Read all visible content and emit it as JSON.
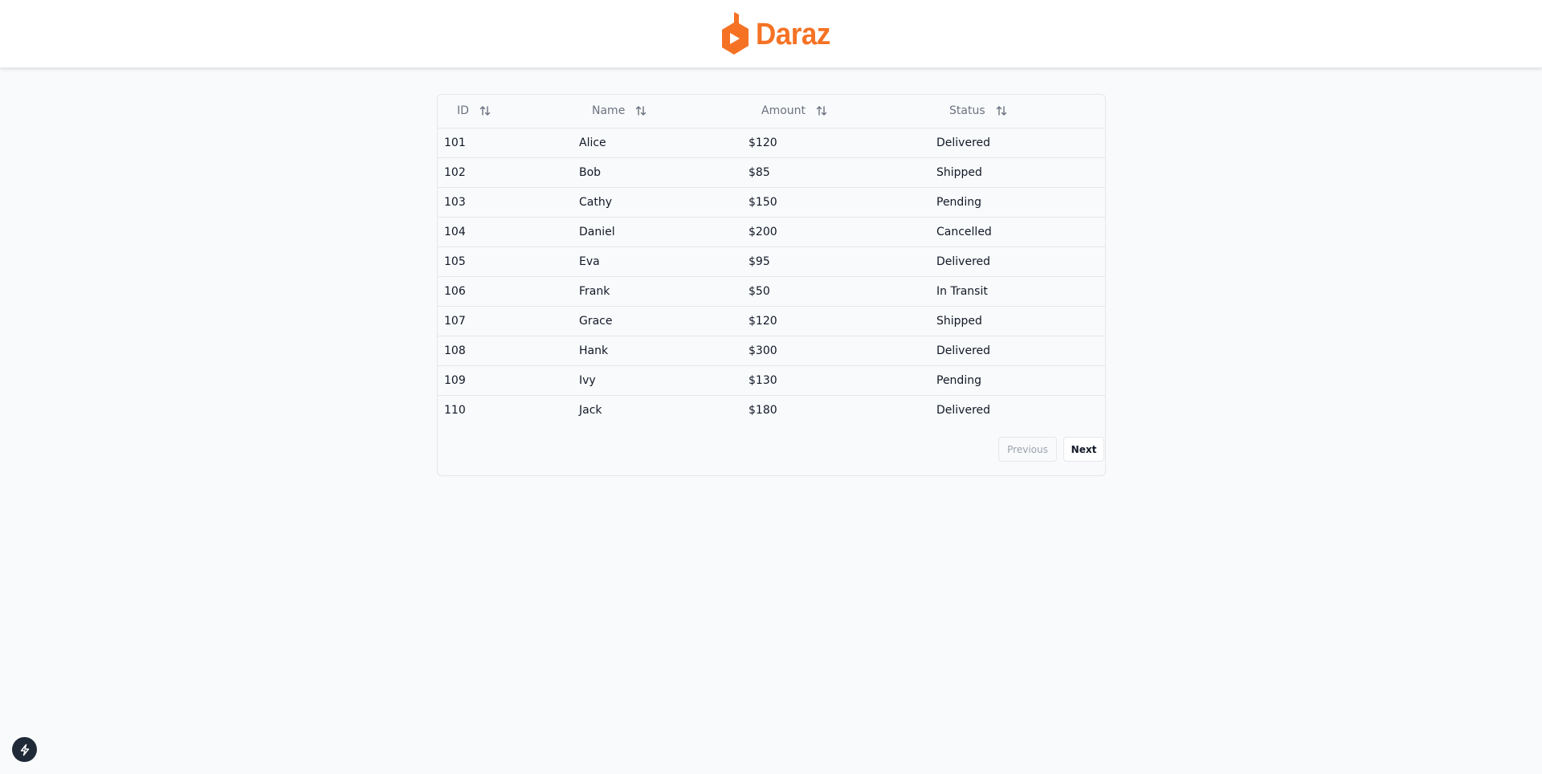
{
  "brand": {
    "name": "Daraz",
    "color": "#f57224"
  },
  "table": {
    "columns": [
      {
        "key": "id",
        "label": "ID"
      },
      {
        "key": "name",
        "label": "Name"
      },
      {
        "key": "amount",
        "label": "Amount"
      },
      {
        "key": "status",
        "label": "Status"
      }
    ],
    "rows": [
      {
        "id": "101",
        "name": "Alice",
        "amount": "$120",
        "status": "Delivered"
      },
      {
        "id": "102",
        "name": "Bob",
        "amount": "$85",
        "status": "Shipped"
      },
      {
        "id": "103",
        "name": "Cathy",
        "amount": "$150",
        "status": "Pending"
      },
      {
        "id": "104",
        "name": "Daniel",
        "amount": "$200",
        "status": "Cancelled"
      },
      {
        "id": "105",
        "name": "Eva",
        "amount": "$95",
        "status": "Delivered"
      },
      {
        "id": "106",
        "name": "Frank",
        "amount": "$50",
        "status": "In Transit"
      },
      {
        "id": "107",
        "name": "Grace",
        "amount": "$120",
        "status": "Shipped"
      },
      {
        "id": "108",
        "name": "Hank",
        "amount": "$300",
        "status": "Delivered"
      },
      {
        "id": "109",
        "name": "Ivy",
        "amount": "$130",
        "status": "Pending"
      },
      {
        "id": "110",
        "name": "Jack",
        "amount": "$180",
        "status": "Delivered"
      }
    ]
  },
  "pagination": {
    "previous_label": "Previous",
    "next_label": "Next"
  },
  "icons": {
    "sort": "sort-arrows-icon",
    "fab": "lightning-bolt-icon"
  }
}
